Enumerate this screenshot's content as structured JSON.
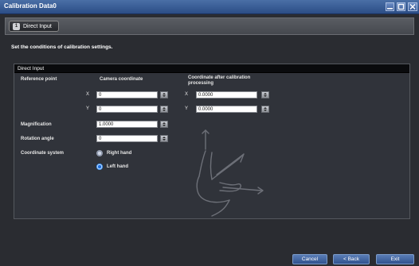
{
  "window": {
    "title": "Calibration Data0",
    "minimize_icon": "minimize-icon",
    "maximize_icon": "maximize-icon",
    "close_icon": "close-icon"
  },
  "step": {
    "number": "1",
    "label": "Direct Input"
  },
  "instruction": "Set the conditions of calibration settings.",
  "panel": {
    "heading": "Direct Input",
    "reference_point_label": "Reference point",
    "camera_coordinate_label": "Camera coordinate",
    "after_calibration_label_line1": "Coordinate after calibration",
    "after_calibration_label_line2": "processing",
    "camera_x_axis": "X",
    "camera_y_axis": "Y",
    "after_x_axis": "X",
    "after_y_axis": "Y",
    "camera_x_value": "0",
    "camera_y_value": "0",
    "after_x_value": "0.0000",
    "after_y_value": "0.0000",
    "magnification_label": "Magnification",
    "magnification_value": "1.0000",
    "rotation_label": "Rotation angle",
    "rotation_value": "0",
    "coordinate_system_label": "Coordinate system",
    "right_hand_label": "Right hand",
    "left_hand_label": "Left hand",
    "selected_system": "Left hand"
  },
  "footer": {
    "cancel_label": "Cancel",
    "back_label": "< Back",
    "exit_label": "Exit"
  },
  "colors": {
    "titlebar": "#2b4d86",
    "background": "#2a2c31",
    "panel": "#30333a",
    "radio_selected": "#1b6fe0"
  }
}
